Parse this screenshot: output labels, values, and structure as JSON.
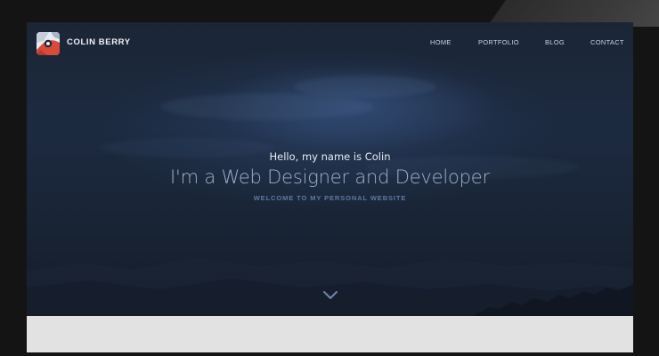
{
  "brand": {
    "name": "COLIN BERRY",
    "logo_icon": "colin-berry-logo-icon"
  },
  "nav": {
    "items": [
      {
        "label": "HOME"
      },
      {
        "label": "PORTFOLIO"
      },
      {
        "label": "BLOG"
      },
      {
        "label": "CONTACT"
      }
    ]
  },
  "hero": {
    "greeting": "Hello, my name is Colin",
    "headline": "I'm a Web Designer and Developer",
    "tagline": "WELCOME TO MY PERSONAL WEBSITE",
    "scroll_icon": "chevron-down-icon"
  },
  "colors": {
    "device_bezel": "#141414",
    "hero_background": "#1b2536",
    "greeting_text": "#e7ecf2",
    "headline_text": "#9fb0c7",
    "tagline_text": "#5e79a4",
    "logo_accent": "#d94a3a",
    "below_section": "#e2e2e2"
  }
}
